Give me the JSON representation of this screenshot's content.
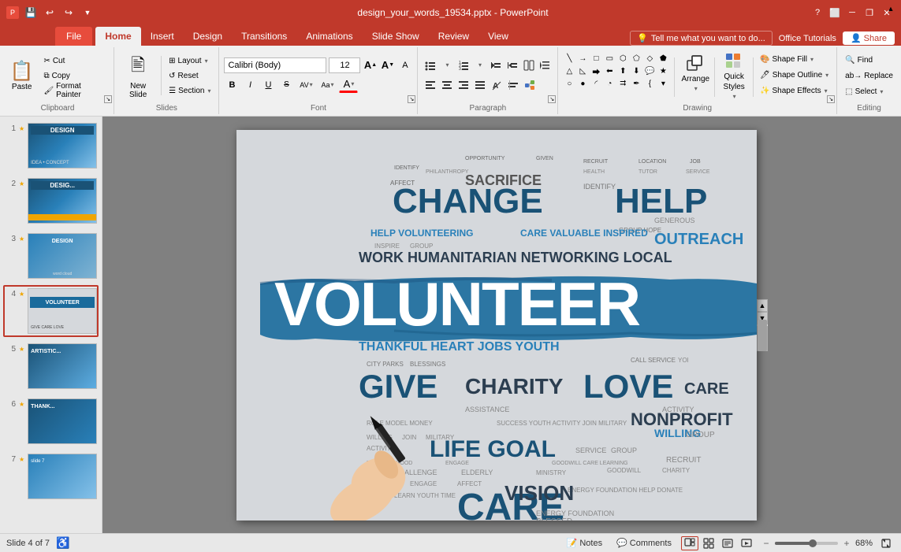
{
  "titleBar": {
    "title": "design_your_words_19534.pptx - PowerPoint",
    "saveIcon": "💾",
    "undoIcon": "↩",
    "redoIcon": "↪",
    "customizeIcon": "▼",
    "minimizeLabel": "─",
    "restoreLabel": "❐",
    "closeLabel": "✕"
  },
  "quickAccess": {
    "save": "💾",
    "undo": "↩",
    "redo": "↪",
    "dropdown": "▾"
  },
  "tabs": {
    "file": "File",
    "home": "Home",
    "insert": "Insert",
    "design": "Design",
    "transitions": "Transitions",
    "animations": "Animations",
    "slideShow": "Slide Show",
    "review": "Review",
    "view": "View",
    "tellMe": "Tell me what you want to do...",
    "officeTutorials": "Office Tutorials",
    "share": "Share"
  },
  "ribbon": {
    "clipboard": {
      "label": "Clipboard",
      "paste": "Paste",
      "cut": "Cut",
      "copy": "Copy",
      "formatPainter": "Format Painter"
    },
    "slides": {
      "label": "Slides",
      "newSlide": "New\nSlide",
      "layout": "Layout",
      "reset": "Reset",
      "section": "Section"
    },
    "font": {
      "label": "Font",
      "fontName": "Calibri (Body)",
      "fontSize": "12",
      "increaseFontSize": "A▲",
      "decreaseFontSize": "A▼",
      "clearFormatting": "A",
      "bold": "B",
      "italic": "I",
      "underline": "U",
      "strikethrough": "S",
      "characterSpacing": "AV",
      "changeCase": "Aa",
      "fontColor": "A"
    },
    "paragraph": {
      "label": "Paragraph",
      "bulletList": "≡",
      "numberedList": "≡",
      "decreaseIndent": "←",
      "increaseIndent": "→",
      "alignLeft": "≡",
      "alignCenter": "≡",
      "alignRight": "≡",
      "justify": "≡",
      "columnLayout": "⊟",
      "textDirection": "A",
      "alignText": "≡",
      "smartArt": "SmartArt",
      "lineSpacing": "↕"
    },
    "drawing": {
      "label": "Drawing",
      "shapeFill": "Shape Fill",
      "shapeOutline": "Shape Outline",
      "shapeEffects": "Shape Effects",
      "arrange": "Arrange",
      "quickStyles": "Quick\nStyles",
      "select": "Select"
    },
    "editing": {
      "label": "Editing",
      "find": "Find",
      "replace": "Replace",
      "select": "Select"
    }
  },
  "slides": [
    {
      "num": "1",
      "star": "★",
      "label": "Design slide 1"
    },
    {
      "num": "2",
      "star": "★",
      "label": "Design slide 2"
    },
    {
      "num": "3",
      "star": "★",
      "label": "Design slide 3"
    },
    {
      "num": "4",
      "star": "★",
      "label": "Volunteer slide",
      "active": true
    },
    {
      "num": "5",
      "star": "★",
      "label": "Artistic slide"
    },
    {
      "num": "6",
      "star": "★",
      "label": "Thank slide"
    },
    {
      "num": "7",
      "star": "★",
      "label": "Slide 7"
    }
  ],
  "canvas": {
    "mainWord": "VOLUNTEER",
    "words": [
      "CHANGE",
      "HELP",
      "SACRIFICE",
      "OUTREACH",
      "WORK HUMANITARIAN NETWORKING LOCAL",
      "HELP VOLUNTEERING CARE VALUABLE INSPIRED",
      "GIVE",
      "CHARITY",
      "LOVE",
      "CARE",
      "NONPROFIT",
      "LIFE GOAL",
      "VISION",
      "THANKFUL HEART JOBS YOUTH",
      "BLESSED"
    ]
  },
  "statusBar": {
    "slideInfo": "Slide 4 of 7",
    "notes": "Notes",
    "comments": "Comments",
    "zoom": "68%",
    "normalViewLabel": "Normal",
    "slideSorterLabel": "Slide Sorter",
    "readingViewLabel": "Reading View",
    "slideshowLabel": "Slide Show"
  }
}
